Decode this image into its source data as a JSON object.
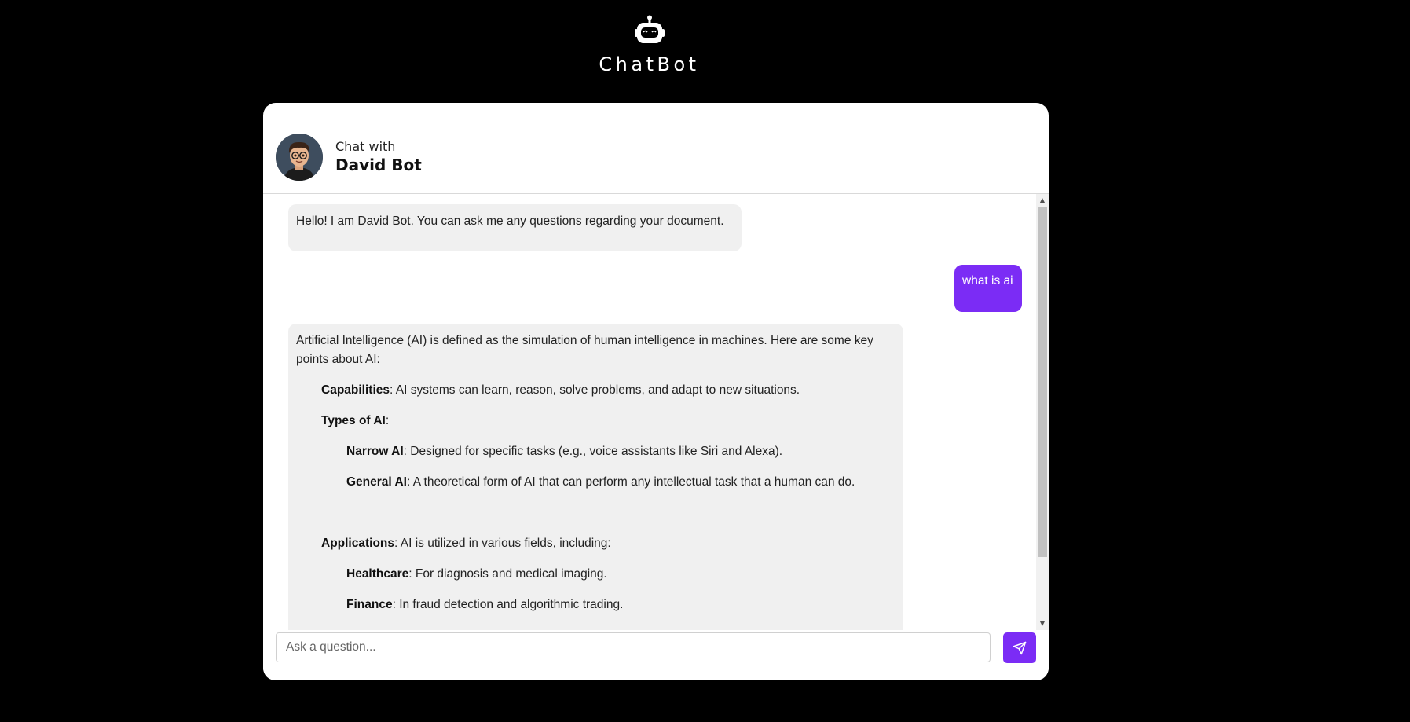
{
  "app": {
    "title": "ChatBot",
    "logo_icon": "robot-icon"
  },
  "chat_header": {
    "chat_with_label": "Chat with",
    "bot_name": "David Bot"
  },
  "messages": {
    "greeting": "Hello! I am David Bot. You can ask me any questions regarding your document.",
    "user_question": "what is ai",
    "answer_intro": "Artificial Intelligence (AI) is defined as the simulation of human intelligence in machines. Here are some key points about AI:",
    "capabilities": {
      "term": "Capabilities",
      "text": ": AI systems can learn, reason, solve problems, and adapt to new situations."
    },
    "types": {
      "term": "Types of AI",
      "text": ":"
    },
    "narrow": {
      "term": "Narrow AI",
      "text": ": Designed for specific tasks (e.g., voice assistants like Siri and Alexa)."
    },
    "general": {
      "term": "General AI",
      "text": ": A theoretical form of AI that can perform any intellectual task that a human can do."
    },
    "applications": {
      "term": "Applications",
      "text": ": AI is utilized in various fields, including:"
    },
    "healthcare": {
      "term": "Healthcare",
      "text": ": For diagnosis and medical imaging."
    },
    "finance": {
      "term": "Finance",
      "text": ": In fraud detection and algorithmic trading."
    }
  },
  "input": {
    "placeholder": "Ask a question...",
    "value": "",
    "send_icon": "send-icon"
  },
  "colors": {
    "background": "#000000",
    "accent": "#7b2cf5",
    "bot_bubble": "#f0f0f0"
  }
}
